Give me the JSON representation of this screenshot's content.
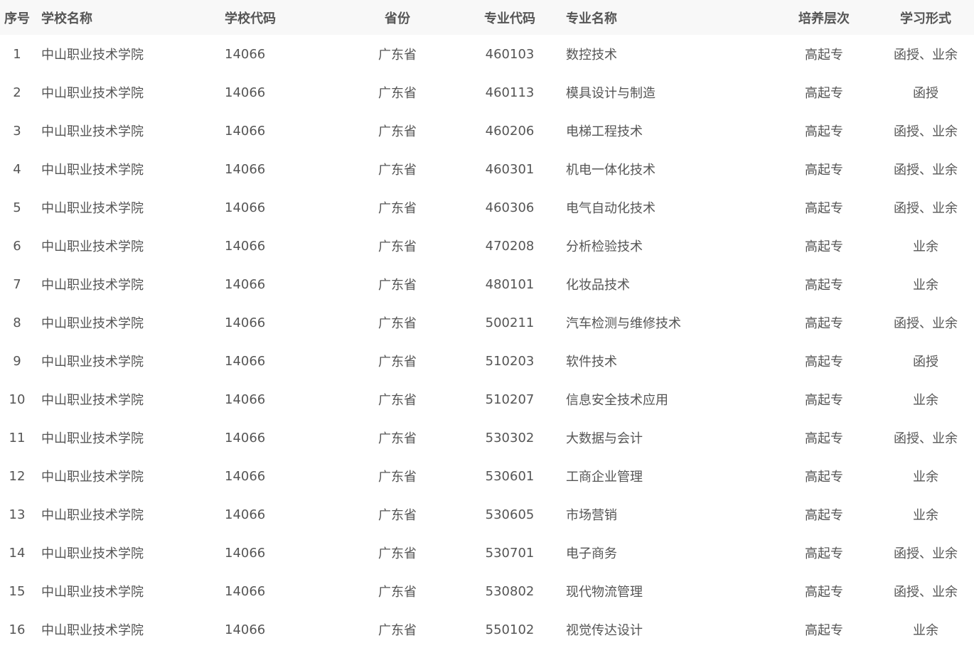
{
  "table": {
    "headers": [
      "序号",
      "学校名称",
      "学校代码",
      "省份",
      "专业代码",
      "专业名称",
      "培养层次",
      "学习形式"
    ],
    "rows": [
      [
        "1",
        "中山职业技术学院",
        "14066",
        "广东省",
        "460103",
        "数控技术",
        "高起专",
        "函授、业余"
      ],
      [
        "2",
        "中山职业技术学院",
        "14066",
        "广东省",
        "460113",
        "模具设计与制造",
        "高起专",
        "函授"
      ],
      [
        "3",
        "中山职业技术学院",
        "14066",
        "广东省",
        "460206",
        "电梯工程技术",
        "高起专",
        "函授、业余"
      ],
      [
        "4",
        "中山职业技术学院",
        "14066",
        "广东省",
        "460301",
        "机电一体化技术",
        "高起专",
        "函授、业余"
      ],
      [
        "5",
        "中山职业技术学院",
        "14066",
        "广东省",
        "460306",
        "电气自动化技术",
        "高起专",
        "函授、业余"
      ],
      [
        "6",
        "中山职业技术学院",
        "14066",
        "广东省",
        "470208",
        "分析检验技术",
        "高起专",
        "业余"
      ],
      [
        "7",
        "中山职业技术学院",
        "14066",
        "广东省",
        "480101",
        "化妆品技术",
        "高起专",
        "业余"
      ],
      [
        "8",
        "中山职业技术学院",
        "14066",
        "广东省",
        "500211",
        "汽车检测与维修技术",
        "高起专",
        "函授、业余"
      ],
      [
        "9",
        "中山职业技术学院",
        "14066",
        "广东省",
        "510203",
        "软件技术",
        "高起专",
        "函授"
      ],
      [
        "10",
        "中山职业技术学院",
        "14066",
        "广东省",
        "510207",
        "信息安全技术应用",
        "高起专",
        "业余"
      ],
      [
        "11",
        "中山职业技术学院",
        "14066",
        "广东省",
        "530302",
        "大数据与会计",
        "高起专",
        "函授、业余"
      ],
      [
        "12",
        "中山职业技术学院",
        "14066",
        "广东省",
        "530601",
        "工商企业管理",
        "高起专",
        "业余"
      ],
      [
        "13",
        "中山职业技术学院",
        "14066",
        "广东省",
        "530605",
        "市场营销",
        "高起专",
        "业余"
      ],
      [
        "14",
        "中山职业技术学院",
        "14066",
        "广东省",
        "530701",
        "电子商务",
        "高起专",
        "函授、业余"
      ],
      [
        "15",
        "中山职业技术学院",
        "14066",
        "广东省",
        "530802",
        "现代物流管理",
        "高起专",
        "函授、业余"
      ],
      [
        "16",
        "中山职业技术学院",
        "14066",
        "广东省",
        "550102",
        "视觉传达设计",
        "高起专",
        "业余"
      ]
    ]
  }
}
